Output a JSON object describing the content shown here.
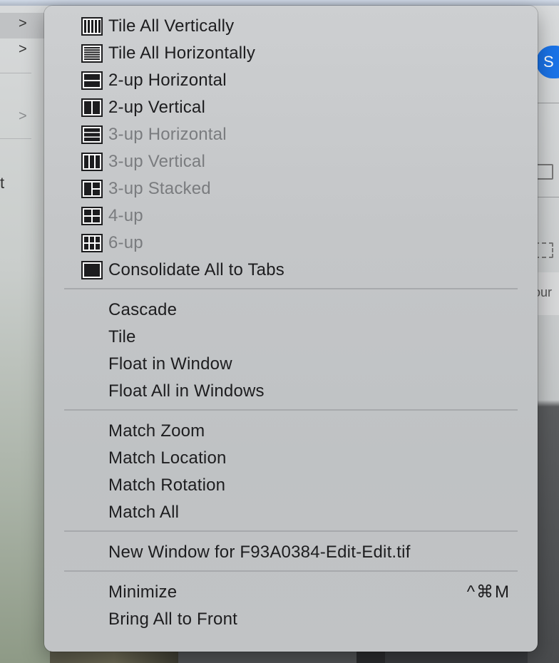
{
  "menu": {
    "groups": [
      [
        {
          "label": "Tile All Vertically",
          "icon": "tile-vertical-icon",
          "enabled": true
        },
        {
          "label": "Tile All Horizontally",
          "icon": "tile-horizontal-icon",
          "enabled": true
        },
        {
          "label": "2-up Horizontal",
          "icon": "two-up-horizontal-icon",
          "enabled": true
        },
        {
          "label": "2-up Vertical",
          "icon": "two-up-vertical-icon",
          "enabled": true
        },
        {
          "label": "3-up Horizontal",
          "icon": "three-up-horizontal-icon",
          "enabled": false
        },
        {
          "label": "3-up Vertical",
          "icon": "three-up-vertical-icon",
          "enabled": false
        },
        {
          "label": "3-up Stacked",
          "icon": "three-up-stacked-icon",
          "enabled": false
        },
        {
          "label": "4-up",
          "icon": "four-up-icon",
          "enabled": false
        },
        {
          "label": "6-up",
          "icon": "six-up-icon",
          "enabled": false
        },
        {
          "label": "Consolidate All to Tabs",
          "icon": "consolidate-tabs-icon",
          "enabled": true
        }
      ],
      [
        {
          "label": "Cascade",
          "enabled": true
        },
        {
          "label": "Tile",
          "enabled": true
        },
        {
          "label": "Float in Window",
          "enabled": true
        },
        {
          "label": "Float All in Windows",
          "enabled": true
        }
      ],
      [
        {
          "label": "Match Zoom",
          "enabled": true
        },
        {
          "label": "Match Location",
          "enabled": true
        },
        {
          "label": "Match Rotation",
          "enabled": true
        },
        {
          "label": "Match All",
          "enabled": true
        }
      ],
      [
        {
          "label": "New Window for F93A0384-Edit-Edit.tif",
          "enabled": true
        }
      ],
      [
        {
          "label": "Minimize",
          "shortcut": "^⌘M",
          "enabled": true
        },
        {
          "label": "Bring All to Front",
          "enabled": true
        }
      ]
    ]
  },
  "background": {
    "left_chevrons": [
      ">",
      ">",
      ">"
    ],
    "left_glyph": "t",
    "right_button_letter": "S",
    "right_tab_text": "our"
  },
  "colors": {
    "enabled_text": "#1d1d1f",
    "disabled_text": "#7a7c7f",
    "accent_button": "#1a73e8"
  }
}
